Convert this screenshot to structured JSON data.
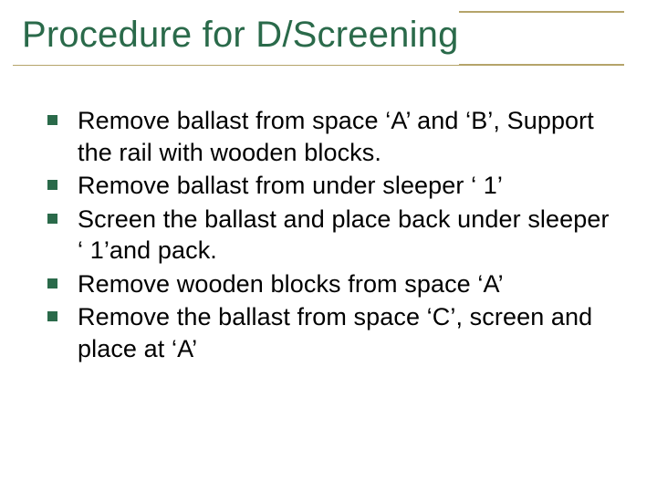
{
  "slide": {
    "title": "Procedure for D/Screening",
    "bullets": [
      "Remove ballast from space ‘A’ and ‘B’, Support the rail with wooden blocks.",
      "Remove ballast from under sleeper ‘ 1’",
      "Screen the ballast and place back under sleeper ‘ 1’and pack.",
      "Remove wooden blocks from space ‘A’",
      "Remove the ballast from space ‘C’, screen and place at ‘A’"
    ]
  }
}
